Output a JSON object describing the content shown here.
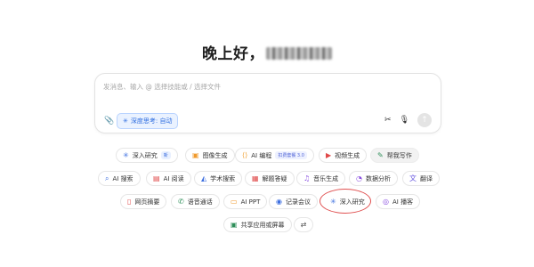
{
  "greeting": {
    "text": "晚上好，"
  },
  "input": {
    "placeholder": "发消息、输入 @ 选择技能或 / 选择文件",
    "deep_think_label": "深度思考: 自动"
  },
  "chips": {
    "deep_research": {
      "label": "深入研究",
      "badge": "新"
    },
    "image_gen": {
      "label": "图像生成"
    },
    "ai_edit": {
      "label": "AI 编程",
      "badge": "扣费套餐 3.0"
    },
    "video_gen": {
      "label": "视频生成"
    },
    "help_write": {
      "label": "帮我写作"
    },
    "ai_search": {
      "label": "AI 搜索"
    },
    "ai_read": {
      "label": "AI 阅读"
    },
    "academic": {
      "label": "学术搜索"
    },
    "solve": {
      "label": "解题答疑"
    },
    "music": {
      "label": "音乐生成"
    },
    "data": {
      "label": "数据分析"
    },
    "translate": {
      "label": "翻译"
    },
    "webpage": {
      "label": "网页摘要"
    },
    "voice_call": {
      "label": "语音通话"
    },
    "ai_ppt": {
      "label": "AI PPT"
    },
    "meeting": {
      "label": "记录会议"
    },
    "deep_research2": {
      "label": "深入研究"
    },
    "podcast": {
      "label": "AI 播客"
    },
    "share_screen": {
      "label": "共享应用或屏幕"
    }
  },
  "colors": {
    "accent": "#2f6ee0",
    "highlight_ring": "#e05050"
  }
}
